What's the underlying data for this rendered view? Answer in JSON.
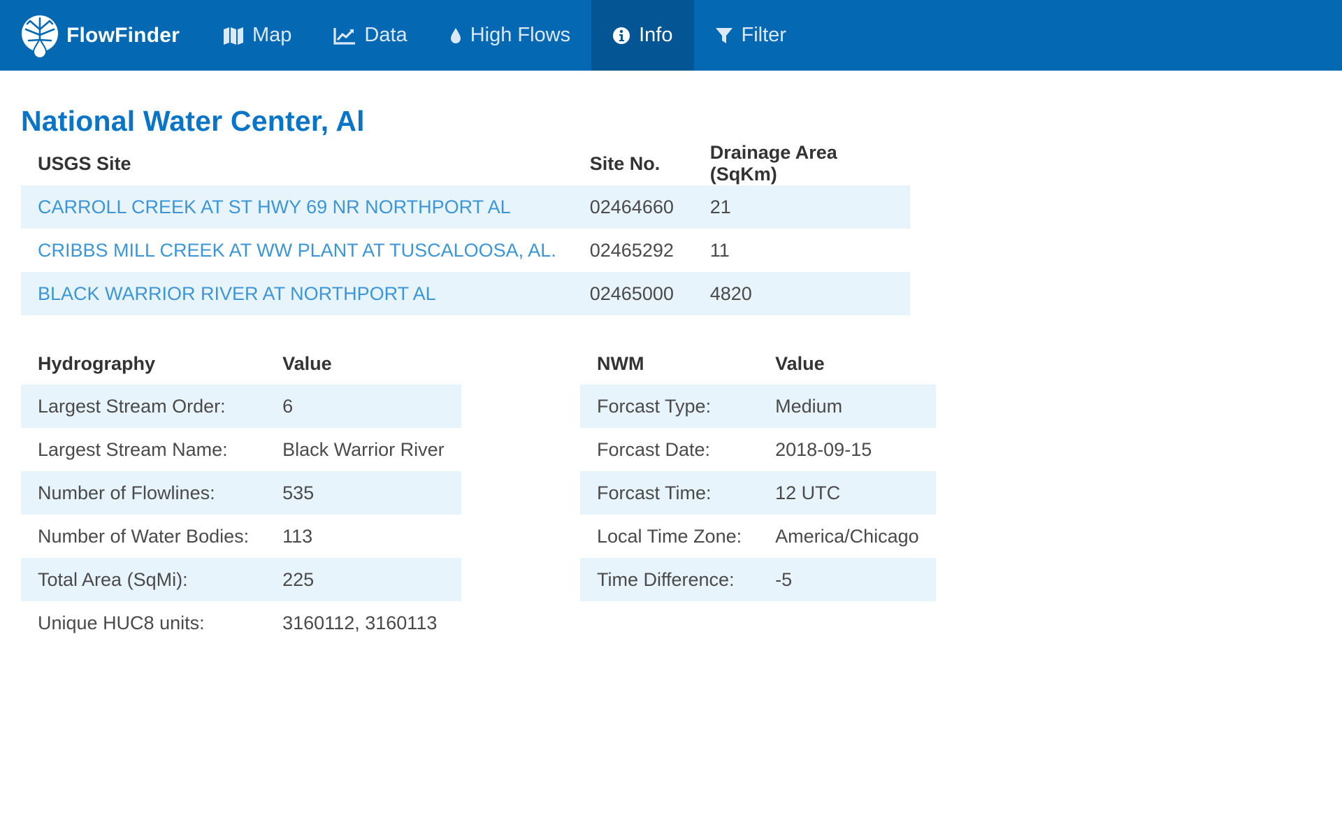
{
  "navbar": {
    "brand": "FlowFinder",
    "items": [
      {
        "label": "Map",
        "icon": "map-icon"
      },
      {
        "label": "Data",
        "icon": "line-chart-icon"
      },
      {
        "label": "High Flows",
        "icon": "water-drop-icon"
      },
      {
        "label": "Info",
        "icon": "info-circle-icon",
        "active": true
      },
      {
        "label": "Filter",
        "icon": "filter-icon"
      }
    ],
    "colors": {
      "background": "#0568b3",
      "active_background": "#035594"
    }
  },
  "page": {
    "title": "National Water Center, Al"
  },
  "sites_table": {
    "headers": [
      "USGS Site",
      "Site No.",
      "Drainage Area (SqKm)"
    ],
    "rows": [
      {
        "site": "CARROLL CREEK AT ST HWY 69 NR NORTHPORT AL",
        "site_no": "02464660",
        "area": "21"
      },
      {
        "site": "CRIBBS MILL CREEK AT WW PLANT AT TUSCALOOSA, AL.",
        "site_no": "02465292",
        "area": "11"
      },
      {
        "site": "BLACK WARRIOR RIVER AT NORTHPORT AL",
        "site_no": "02465000",
        "area": "4820"
      }
    ]
  },
  "hydrography_table": {
    "headers": [
      "Hydrography",
      "Value"
    ],
    "rows": [
      {
        "label": "Largest Stream Order:",
        "value": "6"
      },
      {
        "label": "Largest Stream Name:",
        "value": "Black Warrior River"
      },
      {
        "label": "Number of Flowlines:",
        "value": "535"
      },
      {
        "label": "Number of Water Bodies:",
        "value": "113"
      },
      {
        "label": "Total Area (SqMi):",
        "value": "225"
      },
      {
        "label": "Unique HUC8 units:",
        "value": "3160112, 3160113"
      }
    ]
  },
  "nwm_table": {
    "headers": [
      "NWM",
      "Value"
    ],
    "rows": [
      {
        "label": "Forcast Type:",
        "value": "Medium"
      },
      {
        "label": "Forcast Date:",
        "value": "2018-09-15"
      },
      {
        "label": "Forcast Time:",
        "value": "12 UTC"
      },
      {
        "label": "Local Time Zone:",
        "value": "America/Chicago"
      },
      {
        "label": "Time Difference:",
        "value": "-5"
      }
    ]
  },
  "colors": {
    "title": "#0a74c7",
    "link": "#3c96d6",
    "row_stripe": "#e8f4fc"
  }
}
